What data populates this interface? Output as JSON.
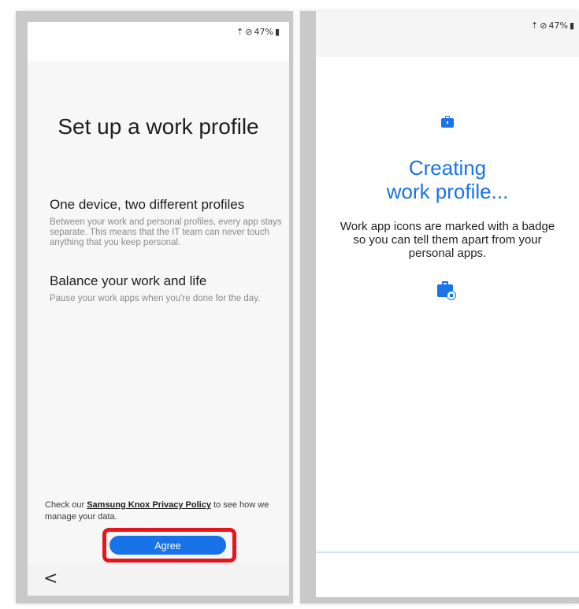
{
  "status": {
    "battery": "47%",
    "icons": [
      "wifi-icon",
      "do-not-disturb-icon",
      "battery-icon"
    ]
  },
  "left_screen": {
    "title": "Set up a work profile",
    "sections": [
      {
        "heading": "One device, two different profiles",
        "body": "Between your work and personal profiles, every app stays separate. This means that the IT team can never touch anything that you keep personal."
      },
      {
        "heading": "Balance your work and life",
        "body": "Pause your work apps when you're done for the day."
      }
    ],
    "privacy": {
      "prefix": "Check our ",
      "link": "Samsung Knox Privacy Policy",
      "suffix": " to see how we manage your data."
    },
    "agree_label": "Agree",
    "back_glyph": "<"
  },
  "right_screen": {
    "title_line1": "Creating",
    "title_line2": "work profile...",
    "description": "Work app icons are marked with a badge so you can tell them apart from your personal apps."
  },
  "colors": {
    "accent": "#1a73e8",
    "highlight": "#e8141c"
  }
}
